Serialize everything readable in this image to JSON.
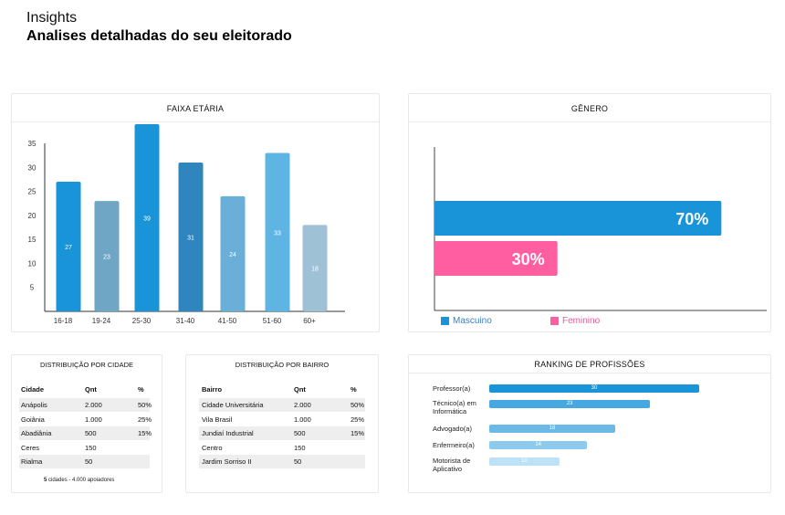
{
  "header": {
    "subtitle": "Insights",
    "title": "Analises detalhadas do seu eleitorado"
  },
  "age_card": {
    "title": "FAIXA ETÁRIA"
  },
  "gender_card": {
    "title": "GÊNERO",
    "legend_male": "Mascuino",
    "legend_female": "Feminino",
    "male_label": "70%",
    "female_label": "30%",
    "colors": {
      "male": "#1a94d8",
      "female": "#ff5ea0"
    }
  },
  "chart_data": [
    {
      "type": "bar",
      "title": "FAIXA ETÁRIA",
      "categories": [
        "16-18",
        "19-24",
        "25-30",
        "31-40",
        "41-50",
        "51-60",
        "60+"
      ],
      "values": [
        27,
        23,
        39,
        31,
        24,
        33,
        18
      ],
      "y_ticks": [
        5,
        10,
        15,
        20,
        25,
        30,
        35
      ],
      "ylim": [
        0,
        40
      ],
      "colors": [
        "#1a94d8",
        "#6fa6c6",
        "#1a94d8",
        "#2f86bf",
        "#6aafd8",
        "#5eb5e4",
        "#9fc1d6"
      ],
      "grid": false
    },
    {
      "type": "bar",
      "title": "GÊNERO",
      "orientation": "horizontal",
      "categories": [
        "Mascuino",
        "Feminino"
      ],
      "values": [
        70,
        30
      ],
      "unit": "%"
    },
    {
      "type": "bar",
      "title": "RANKING DE PROFISSÕES",
      "orientation": "horizontal",
      "categories": [
        "Professor(a)",
        "Técnico(a) em Informática",
        "Advogado(a)",
        "Enfermeiro(a)",
        "Motorista de Aplicativo"
      ],
      "values": [
        30,
        23,
        18,
        14,
        10
      ],
      "colors": [
        "#1a94d8",
        "#45a8e0",
        "#6ab9e6",
        "#8ccbee",
        "#bde2f7"
      ]
    }
  ],
  "city_table": {
    "title": "DISTRIBUIÇÃO POR CIDADE",
    "headers": [
      "Cidade",
      "Qnt",
      "%"
    ],
    "rows": [
      [
        "Anápolis",
        "2.000",
        "50%"
      ],
      [
        "Goiânia",
        "1.000",
        "25%"
      ],
      [
        "Abadiânia",
        "500",
        "15%"
      ],
      [
        "Ceres",
        "150",
        ""
      ],
      [
        "Rialma",
        "50",
        ""
      ]
    ],
    "footer_count": "5",
    "footer_text": "cidades -  4.000 apoiadores"
  },
  "bairro_table": {
    "title": "DISTRIBUIÇÃO POR BAIRRO",
    "headers": [
      "Bairro",
      "Qnt",
      "%"
    ],
    "rows": [
      [
        "Cidade Universitária",
        "2.000",
        "50%"
      ],
      [
        "Vila Brasil",
        "1.000",
        "25%"
      ],
      [
        "Jundiaí Industrial",
        "500",
        "15%"
      ],
      [
        "Centro",
        "150",
        ""
      ],
      [
        "Jardim Sorriso II",
        "50",
        ""
      ]
    ]
  },
  "ranking": {
    "title": "RANKING DE PROFISSÕES",
    "items": [
      {
        "label": "Professor(a)",
        "value": "30"
      },
      {
        "label": "Técnico(a) em Informática",
        "value": "23"
      },
      {
        "label": "Advogado(a)",
        "value": "18"
      },
      {
        "label": "Enfermeiro(a)",
        "value": "14"
      },
      {
        "label": "Motorista de Aplicativo",
        "value": "10"
      }
    ]
  }
}
